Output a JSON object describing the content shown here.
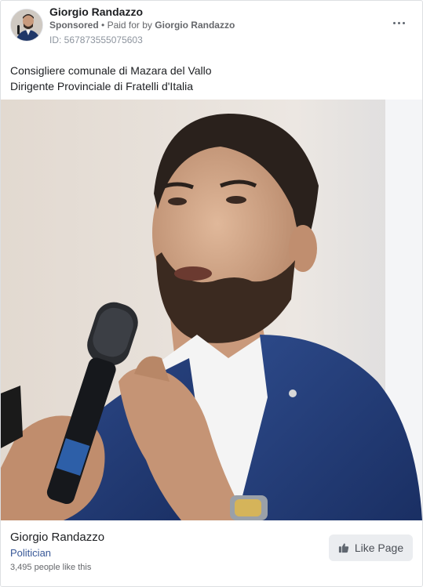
{
  "header": {
    "page_name": "Giorgio Randazzo",
    "sponsored": "Sponsored",
    "separator": "•",
    "paid_for_prefix": "Paid for by",
    "payer": "Giorgio Randazzo",
    "ad_id": "ID: 567873555075603",
    "more_icon": "more-horizontal-icon"
  },
  "post": {
    "line1": "Consigliere comunale di Mazara del Vallo",
    "line2": "Dirigente Provinciale di Fratelli d'Italia"
  },
  "footer": {
    "page_name": "Giorgio Randazzo",
    "category": "Politician",
    "likes": "3,495 people like this",
    "like_button": "Like Page",
    "like_icon": "thumbs-up-icon"
  },
  "colors": {
    "link_blue": "#385898",
    "button_bg": "#ebedf0",
    "secondary_text": "#65676b"
  }
}
